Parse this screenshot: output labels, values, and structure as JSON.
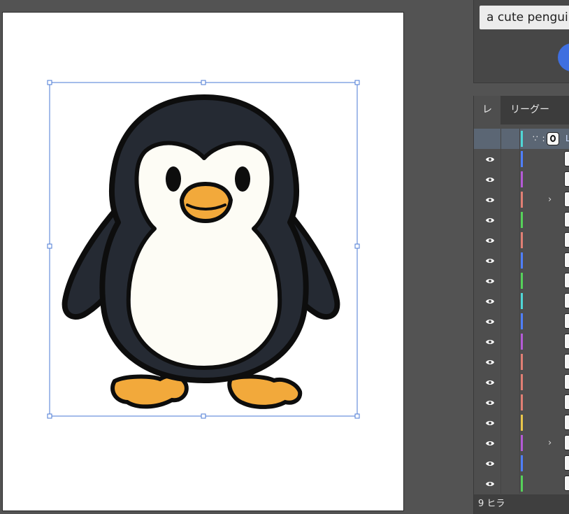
{
  "prompt": {
    "text": "a cute penguin"
  },
  "layers_panel": {
    "tabs": [
      "レ",
      "リーグー"
    ],
    "header_row": {
      "icons": "∵ :",
      "label": "L"
    },
    "rows": [
      {
        "color": "#4f7fff",
        "expandable": false
      },
      {
        "color": "#b45ad6",
        "expandable": false
      },
      {
        "color": "#e07f74",
        "expandable": true
      },
      {
        "color": "#56d15a",
        "expandable": false
      },
      {
        "color": "#e07f74",
        "expandable": false
      },
      {
        "color": "#4f7fff",
        "expandable": false
      },
      {
        "color": "#56d15a",
        "expandable": false
      },
      {
        "color": "#4fd6d6",
        "expandable": false
      },
      {
        "color": "#4f7fff",
        "expandable": false
      },
      {
        "color": "#b45ad6",
        "expandable": false
      },
      {
        "color": "#e07f74",
        "expandable": false
      },
      {
        "color": "#e07f74",
        "expandable": false
      },
      {
        "color": "#e07f74",
        "expandable": false
      },
      {
        "color": "#e8c64a",
        "expandable": false
      },
      {
        "color": "#b45ad6",
        "expandable": true
      },
      {
        "color": "#4f7fff",
        "expandable": false
      },
      {
        "color": "#56d15a",
        "expandable": false
      }
    ],
    "chevron_glyph": "›",
    "footer": "9 ヒラ"
  },
  "colors": {
    "selection": "#4a78d4",
    "penguin_body": "#252a33",
    "penguin_outline": "#0d0d0d",
    "penguin_belly": "#fdfcf5",
    "penguin_beak": "#f2a93b"
  }
}
